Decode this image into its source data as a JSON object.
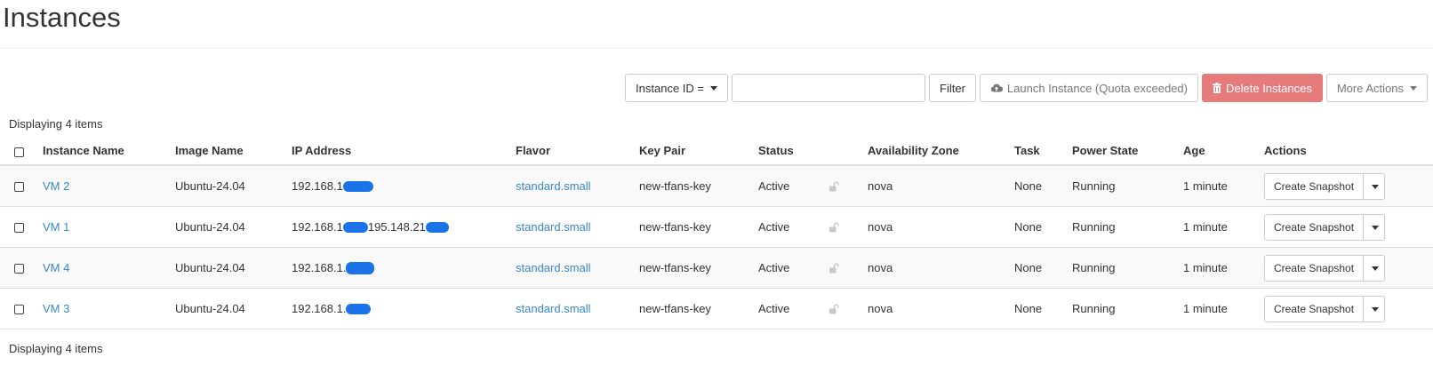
{
  "page": {
    "title": "Instances",
    "count_text_top": "Displaying 4 items",
    "count_text_bottom": "Displaying 4 items"
  },
  "toolbar": {
    "filter_field_label": "Instance ID =",
    "filter_input_value": "",
    "filter_button": "Filter",
    "launch_button": "Launch Instance (Quota exceeded)",
    "delete_button": "Delete Instances",
    "more_actions_button": "More Actions"
  },
  "columns": {
    "instance_name": "Instance Name",
    "image_name": "Image Name",
    "ip_address": "IP Address",
    "flavor": "Flavor",
    "key_pair": "Key Pair",
    "status": "Status",
    "availability_zone": "Availability Zone",
    "task": "Task",
    "power_state": "Power State",
    "age": "Age",
    "actions": "Actions"
  },
  "rows": [
    {
      "name": "VM 2",
      "image": "Ubuntu-24.04",
      "ip_prefix": "192.168.1",
      "ip_second": "",
      "flavor": "standard.small",
      "key_pair": "new-tfans-key",
      "status": "Active",
      "zone": "nova",
      "task": "None",
      "power": "Running",
      "age": "1 minute",
      "action": "Create Snapshot"
    },
    {
      "name": "VM 1",
      "image": "Ubuntu-24.04",
      "ip_prefix": "192.168.1",
      "ip_second": "195.148.21",
      "flavor": "standard.small",
      "key_pair": "new-tfans-key",
      "status": "Active",
      "zone": "nova",
      "task": "None",
      "power": "Running",
      "age": "1 minute",
      "action": "Create Snapshot"
    },
    {
      "name": "VM 4",
      "image": "Ubuntu-24.04",
      "ip_prefix": "192.168.1.",
      "ip_second": "",
      "flavor": "standard.small",
      "key_pair": "new-tfans-key",
      "status": "Active",
      "zone": "nova",
      "task": "None",
      "power": "Running",
      "age": "1 minute",
      "action": "Create Snapshot"
    },
    {
      "name": "VM 3",
      "image": "Ubuntu-24.04",
      "ip_prefix": "192.168.1.",
      "ip_second": "",
      "flavor": "standard.small",
      "key_pair": "new-tfans-key",
      "status": "Active",
      "zone": "nova",
      "task": "None",
      "power": "Running",
      "age": "1 minute",
      "action": "Create Snapshot"
    }
  ],
  "colors": {
    "link": "#3a87c8",
    "danger_button": "#e57b7b",
    "redaction": "#1a73e8",
    "row_stripe": "#f9f9f9"
  },
  "icons": {
    "launch": "cloud-upload-icon",
    "delete": "trash-icon",
    "status_lock": "unlock-icon",
    "dropdown": "caret-down-icon"
  }
}
